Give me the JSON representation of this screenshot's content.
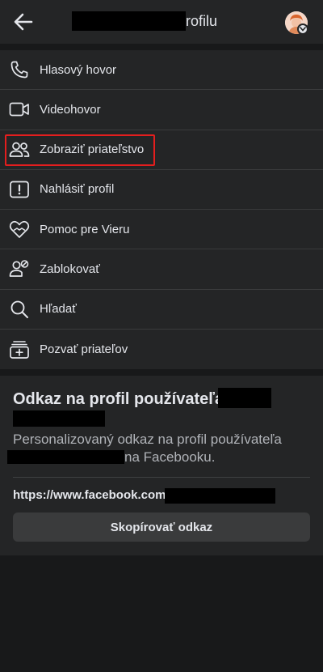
{
  "header": {
    "title_suffix": "rofilu",
    "back_icon": "arrow-left-icon",
    "avatar_icon": "avatar-icon"
  },
  "menu": {
    "items": [
      {
        "label": "Hlasový hovor",
        "icon": "phone-icon"
      },
      {
        "label": "Videohovor",
        "icon": "video-camera-icon"
      },
      {
        "label": "Zobraziť priateľstvo",
        "icon": "friends-icon"
      },
      {
        "label": "Nahlásiť profil",
        "icon": "report-icon"
      },
      {
        "label": "Pomoc pre Vieru",
        "icon": "heart-hands-icon"
      },
      {
        "label": "Zablokovať",
        "icon": "block-user-icon"
      },
      {
        "label": "Hľadať",
        "icon": "search-icon"
      },
      {
        "label": "Pozvať priateľov",
        "icon": "invite-icon"
      }
    ],
    "highlight_color": "#e41e1e"
  },
  "profile_link": {
    "heading": "Odkaz na profil používateľa",
    "description_line1": "Personalizovaný odkaz na profil používateľa",
    "description_line2": "na Facebooku.",
    "url": "https://www.facebook.com",
    "copy_button": "Skopírovať odkaz"
  },
  "colors": {
    "background": "#18191a",
    "surface": "#242526",
    "text_primary": "#e4e6eb",
    "text_secondary": "#b0b3b8",
    "button_bg": "#3a3b3c"
  }
}
